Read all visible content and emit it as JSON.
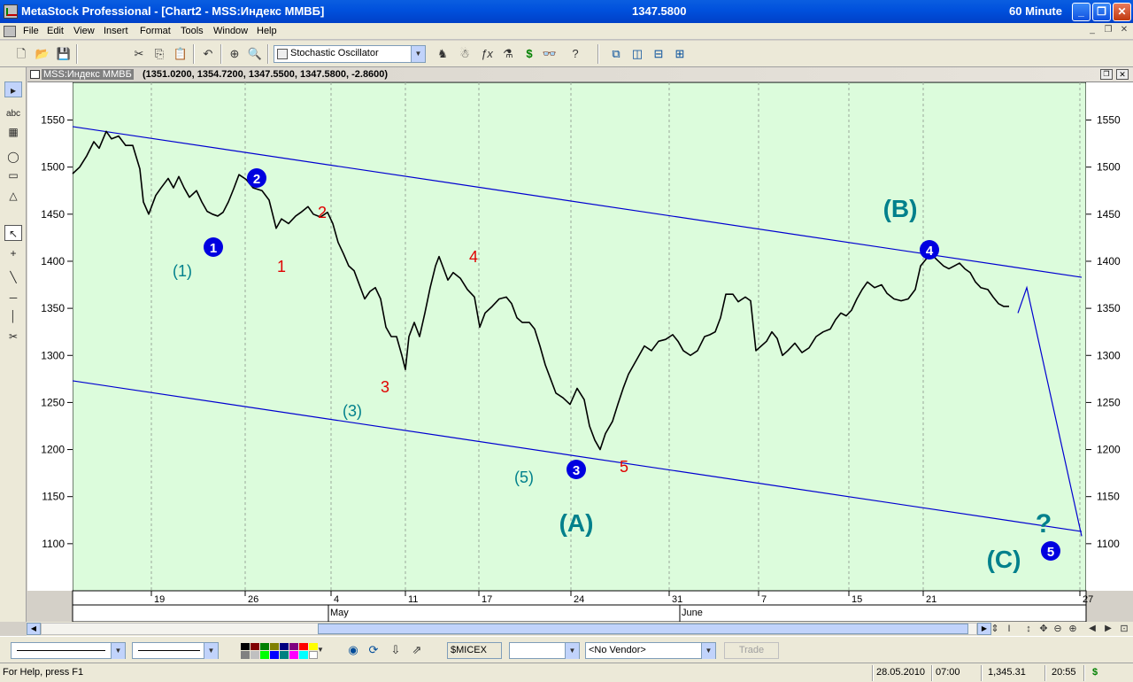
{
  "window": {
    "title": "MetaStock Professional - [Chart2 - MSS:Индекс ММВБ]",
    "last_price": "1347.5800",
    "interval": "60 Minute"
  },
  "menu": [
    "File",
    "Edit",
    "View",
    "Insert",
    "Format",
    "Tools",
    "Window",
    "Help"
  ],
  "toolbar": {
    "study_select": "Stochastic Oscillator"
  },
  "chart": {
    "symbol": "MSS:Индекс ММВБ",
    "ohlc": "(1351.0200, 1354.7200, 1347.5500, 1347.5800, -2.8600)",
    "y_ticks": [
      "1550",
      "1500",
      "1450",
      "1400",
      "1350",
      "1300",
      "1250",
      "1200",
      "1150",
      "1100"
    ],
    "day_ticks": [
      "19",
      "26",
      "4",
      "11",
      "17",
      "24",
      "31",
      "7",
      "15",
      "21",
      "27"
    ],
    "months": [
      "May",
      "June"
    ],
    "labels": {
      "w1": "(1)",
      "w3": "(3)",
      "w5": "(5)",
      "c1": "1",
      "c2": "2",
      "c3": "3",
      "c4": "4",
      "c5": "5",
      "A": "(A)",
      "B": "(B)",
      "C": "(C)",
      "q": "?",
      "b1": "1",
      "b2": "2",
      "b3": "3",
      "b4": "4",
      "b5": "5"
    },
    "colors": {
      "bg": "#dcfcdc",
      "price": "#000000",
      "channel": "#0000d0",
      "teal": "#00808c",
      "red": "#e00000",
      "badge": "#0000e0"
    }
  },
  "chart_data": {
    "type": "line",
    "ylim": [
      1050,
      1590
    ],
    "channel_upper": [
      [
        0,
        1543
      ],
      [
        1140,
        1383
      ]
    ],
    "channel_lower": [
      [
        0,
        1273
      ],
      [
        1140,
        1113
      ]
    ],
    "projection": [
      [
        1068,
        1345
      ],
      [
        1078,
        1372
      ],
      [
        1140,
        1108
      ]
    ],
    "price_path": [
      [
        0,
        1493
      ],
      [
        8,
        1500
      ],
      [
        16,
        1512
      ],
      [
        24,
        1527
      ],
      [
        30,
        1520
      ],
      [
        38,
        1538
      ],
      [
        44,
        1530
      ],
      [
        52,
        1533
      ],
      [
        60,
        1523
      ],
      [
        68,
        1523
      ],
      [
        76,
        1498
      ],
      [
        80,
        1463
      ],
      [
        86,
        1450
      ],
      [
        94,
        1470
      ],
      [
        100,
        1478
      ],
      [
        108,
        1488
      ],
      [
        114,
        1478
      ],
      [
        120,
        1490
      ],
      [
        126,
        1478
      ],
      [
        132,
        1468
      ],
      [
        140,
        1475
      ],
      [
        146,
        1463
      ],
      [
        152,
        1453
      ],
      [
        158,
        1450
      ],
      [
        164,
        1448
      ],
      [
        170,
        1452
      ],
      [
        176,
        1463
      ],
      [
        182,
        1477
      ],
      [
        188,
        1492
      ],
      [
        196,
        1487
      ],
      [
        204,
        1478
      ],
      [
        214,
        1475
      ],
      [
        222,
        1465
      ],
      [
        230,
        1435
      ],
      [
        236,
        1445
      ],
      [
        244,
        1440
      ],
      [
        252,
        1448
      ],
      [
        258,
        1452
      ],
      [
        266,
        1458
      ],
      [
        272,
        1450
      ],
      [
        280,
        1447
      ],
      [
        288,
        1452
      ],
      [
        294,
        1440
      ],
      [
        300,
        1420
      ],
      [
        306,
        1408
      ],
      [
        312,
        1395
      ],
      [
        318,
        1390
      ],
      [
        324,
        1375
      ],
      [
        330,
        1360
      ],
      [
        336,
        1368
      ],
      [
        342,
        1372
      ],
      [
        348,
        1360
      ],
      [
        354,
        1330
      ],
      [
        360,
        1320
      ],
      [
        366,
        1320
      ],
      [
        372,
        1300
      ],
      [
        376,
        1285
      ],
      [
        380,
        1320
      ],
      [
        386,
        1335
      ],
      [
        392,
        1320
      ],
      [
        398,
        1345
      ],
      [
        404,
        1372
      ],
      [
        410,
        1395
      ],
      [
        414,
        1405
      ],
      [
        418,
        1395
      ],
      [
        424,
        1380
      ],
      [
        430,
        1388
      ],
      [
        438,
        1382
      ],
      [
        446,
        1370
      ],
      [
        454,
        1362
      ],
      [
        460,
        1330
      ],
      [
        466,
        1345
      ],
      [
        474,
        1352
      ],
      [
        482,
        1360
      ],
      [
        490,
        1362
      ],
      [
        496,
        1355
      ],
      [
        502,
        1340
      ],
      [
        508,
        1335
      ],
      [
        516,
        1335
      ],
      [
        522,
        1328
      ],
      [
        528,
        1310
      ],
      [
        534,
        1290
      ],
      [
        540,
        1275
      ],
      [
        546,
        1260
      ],
      [
        554,
        1255
      ],
      [
        562,
        1248
      ],
      [
        570,
        1265
      ],
      [
        578,
        1253
      ],
      [
        584,
        1225
      ],
      [
        590,
        1210
      ],
      [
        596,
        1200
      ],
      [
        602,
        1217
      ],
      [
        610,
        1230
      ],
      [
        616,
        1248
      ],
      [
        622,
        1265
      ],
      [
        628,
        1280
      ],
      [
        634,
        1290
      ],
      [
        640,
        1300
      ],
      [
        646,
        1310
      ],
      [
        654,
        1305
      ],
      [
        662,
        1315
      ],
      [
        670,
        1317
      ],
      [
        678,
        1322
      ],
      [
        684,
        1315
      ],
      [
        690,
        1305
      ],
      [
        698,
        1300
      ],
      [
        706,
        1305
      ],
      [
        714,
        1320
      ],
      [
        720,
        1322
      ],
      [
        726,
        1325
      ],
      [
        732,
        1340
      ],
      [
        738,
        1365
      ],
      [
        746,
        1365
      ],
      [
        752,
        1357
      ],
      [
        760,
        1362
      ],
      [
        766,
        1358
      ],
      [
        772,
        1305
      ],
      [
        778,
        1310
      ],
      [
        784,
        1315
      ],
      [
        790,
        1325
      ],
      [
        796,
        1318
      ],
      [
        802,
        1300
      ],
      [
        808,
        1305
      ],
      [
        816,
        1313
      ],
      [
        824,
        1303
      ],
      [
        832,
        1308
      ],
      [
        840,
        1320
      ],
      [
        848,
        1325
      ],
      [
        856,
        1328
      ],
      [
        862,
        1338
      ],
      [
        868,
        1345
      ],
      [
        874,
        1342
      ],
      [
        880,
        1348
      ],
      [
        886,
        1360
      ],
      [
        892,
        1370
      ],
      [
        898,
        1378
      ],
      [
        906,
        1372
      ],
      [
        914,
        1375
      ],
      [
        920,
        1366
      ],
      [
        928,
        1360
      ],
      [
        936,
        1358
      ],
      [
        944,
        1360
      ],
      [
        952,
        1370
      ],
      [
        958,
        1395
      ],
      [
        964,
        1402
      ],
      [
        970,
        1408
      ],
      [
        976,
        1402
      ],
      [
        984,
        1395
      ],
      [
        990,
        1392
      ],
      [
        996,
        1395
      ],
      [
        1002,
        1398
      ],
      [
        1008,
        1392
      ],
      [
        1014,
        1388
      ],
      [
        1020,
        1378
      ],
      [
        1026,
        1372
      ],
      [
        1034,
        1370
      ],
      [
        1040,
        1362
      ],
      [
        1046,
        1355
      ],
      [
        1052,
        1352
      ],
      [
        1058,
        1352
      ]
    ]
  },
  "bottom": {
    "symbol_field": "$MICEX",
    "vendor": "<No Vendor>",
    "trade": "Trade"
  },
  "status": {
    "help": "For Help, press F1",
    "date": "28.05.2010",
    "time": "07:00",
    "price": "1,345.31",
    "clock": "20:55"
  }
}
